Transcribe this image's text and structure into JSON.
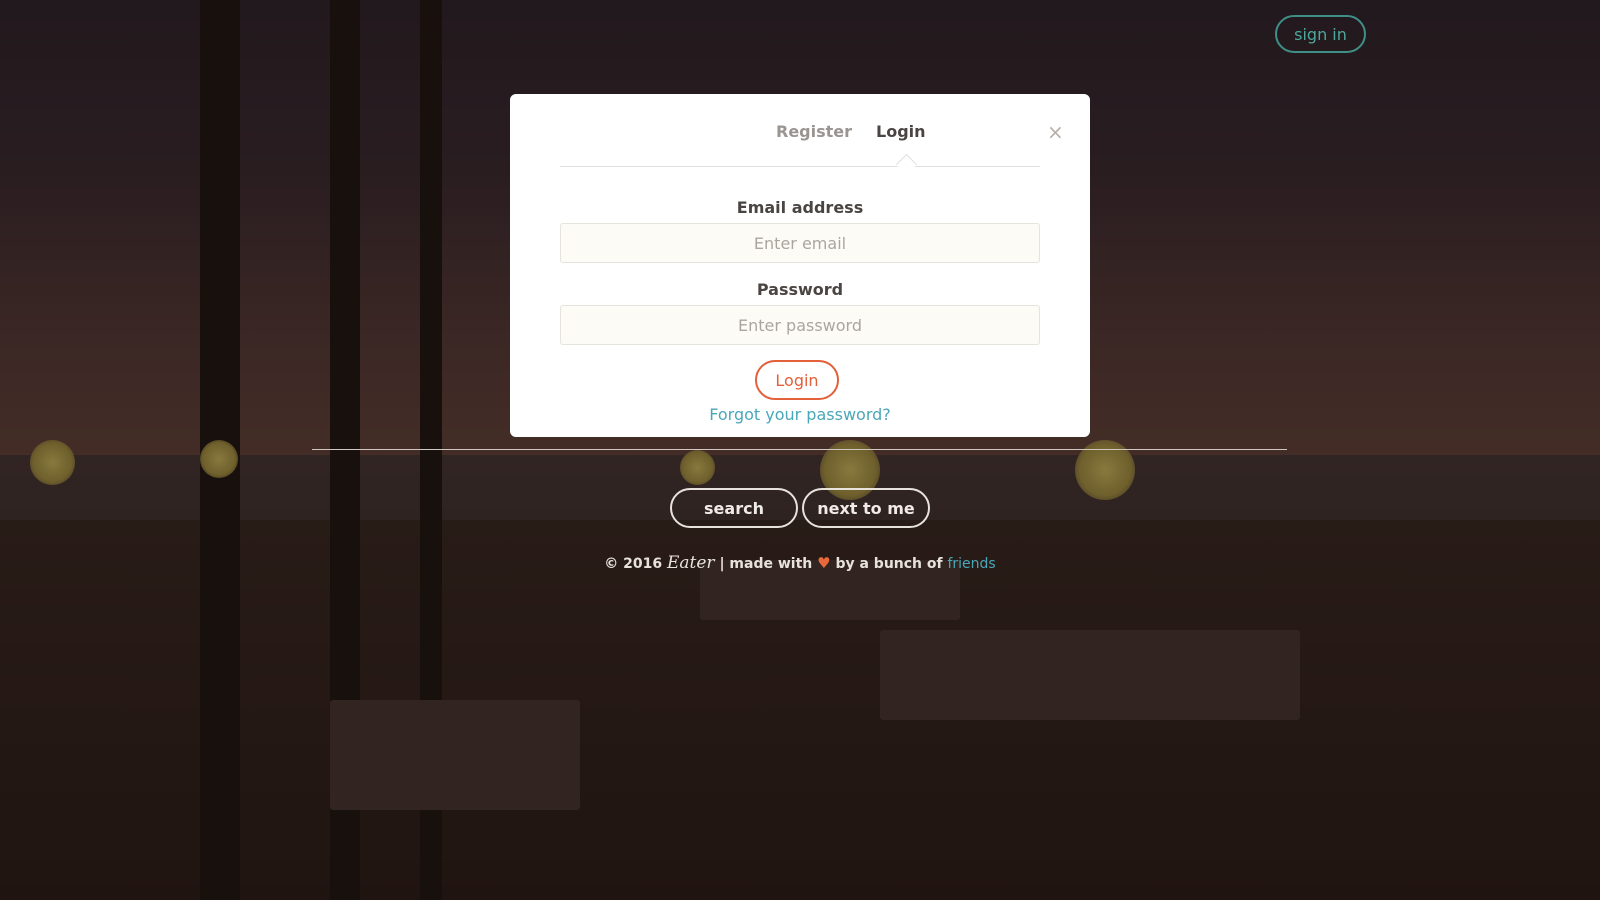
{
  "header": {
    "signin_label": "sign in"
  },
  "modal": {
    "tabs": [
      {
        "label": "Register"
      },
      {
        "label": "Login"
      }
    ],
    "close_glyph": "×",
    "email_label": "Email address",
    "email_placeholder": "Enter email",
    "email_value": "",
    "password_label": "Password",
    "password_placeholder": "Enter password",
    "password_value": "",
    "submit_label": "Login",
    "forgot_label": "Forgot your password?"
  },
  "actions": {
    "search_label": "search",
    "nearby_label": "next to me"
  },
  "footer": {
    "copyright": "© 2016",
    "brand": "Eater",
    "made_with": "| made with",
    "heart_glyph": "♥",
    "by": "by a bunch of",
    "friends_link": "friends"
  },
  "colors": {
    "accent_teal": "#4ea79c",
    "login_orange": "#e2603a",
    "link_blue": "#4aa7b8",
    "heart": "#e86a3c"
  },
  "icons": {
    "close": "close-icon",
    "heart": "heart-icon"
  }
}
